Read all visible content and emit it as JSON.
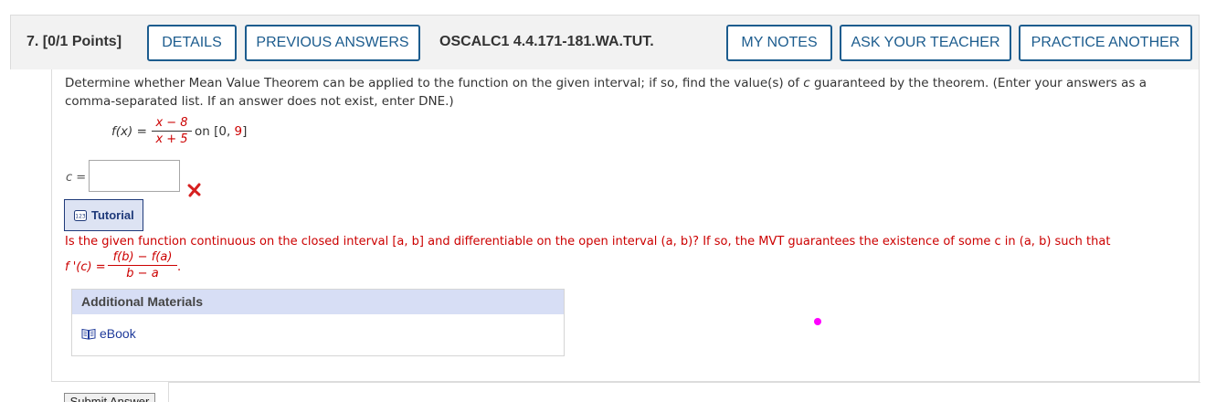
{
  "header": {
    "question_number": "7.",
    "points": "[0/1 Points]",
    "details_label": "DETAILS",
    "previous_answers_label": "PREVIOUS ANSWERS",
    "question_id": "OSCALC1 4.4.171-181.WA.TUT.",
    "my_notes_label": "MY NOTES",
    "ask_teacher_label": "ASK YOUR TEACHER",
    "practice_another_label": "PRACTICE ANOTHER"
  },
  "question": {
    "prompt_part1": "Determine whether Mean Value Theorem can be applied to the function on the given interval; if so, find the value(s) of ",
    "prompt_var": "c",
    "prompt_part2": " guaranteed by the theorem. (Enter your answers as a comma-separated list. If an answer does not exist, enter DNE.)",
    "function_lhs": "f(x) =",
    "numerator": "x − 8",
    "denominator": "x + 5",
    "interval_text": "on [0, ",
    "interval_end": "9",
    "interval_close": "]"
  },
  "answer": {
    "label": "c =",
    "value": "",
    "status": "incorrect"
  },
  "tutorial": {
    "label": "Tutorial",
    "icon": "calculator-icon"
  },
  "hint": {
    "text": "Is the given function continuous on the closed interval [a, b] and differentiable on the open interval (a, b)? If so, the MVT guarantees the existence of some c in (a, b) such that",
    "lhs": "f '(c) =",
    "numerator": "f(b) − f(a)",
    "denominator": "b − a",
    "end": "."
  },
  "additional_materials": {
    "title": "Additional Materials",
    "ebook_label": "eBook",
    "ebook_icon": "book-icon"
  },
  "submit": {
    "label": "Submit Answer"
  },
  "colors": {
    "accent": "#1c5c8e",
    "error": "#cc0000",
    "cursor_dot": "#ff00ff"
  }
}
